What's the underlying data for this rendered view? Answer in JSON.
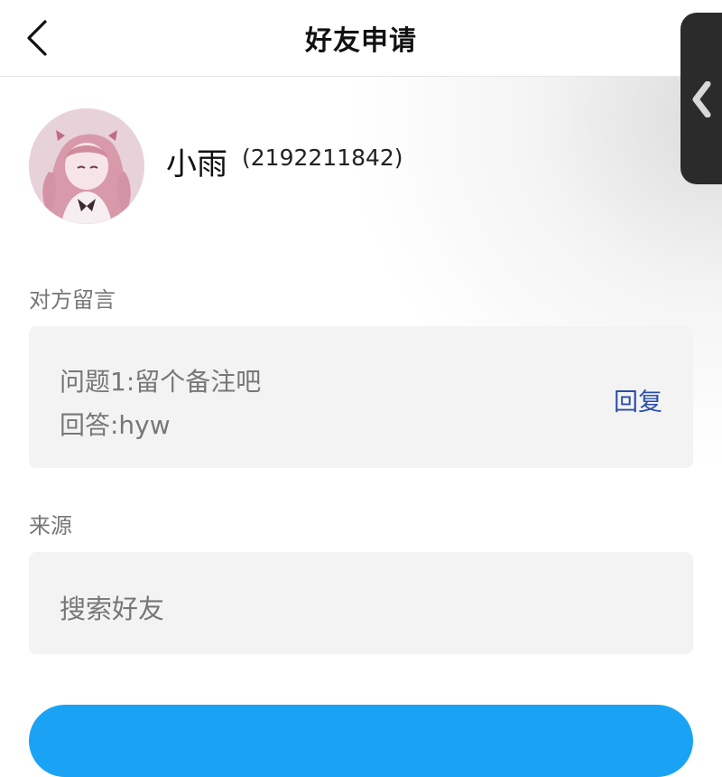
{
  "header": {
    "title": "好友申请",
    "back_icon": "chevron-left-icon"
  },
  "side_handle": {
    "icon": "chevron-left-icon"
  },
  "profile": {
    "name": "小雨",
    "id_text": "(2192211842)"
  },
  "message_section": {
    "label": "对方留言",
    "question": "问题1:留个备注吧",
    "answer": "回答:hyw",
    "reply_label": "回复"
  },
  "source_section": {
    "label": "来源",
    "value": "搜索好友"
  },
  "colors": {
    "accent": "#2a4fa8",
    "primary_button": "#1aa3f5",
    "card_bg": "#f3f3f3",
    "muted_text": "#777777"
  }
}
